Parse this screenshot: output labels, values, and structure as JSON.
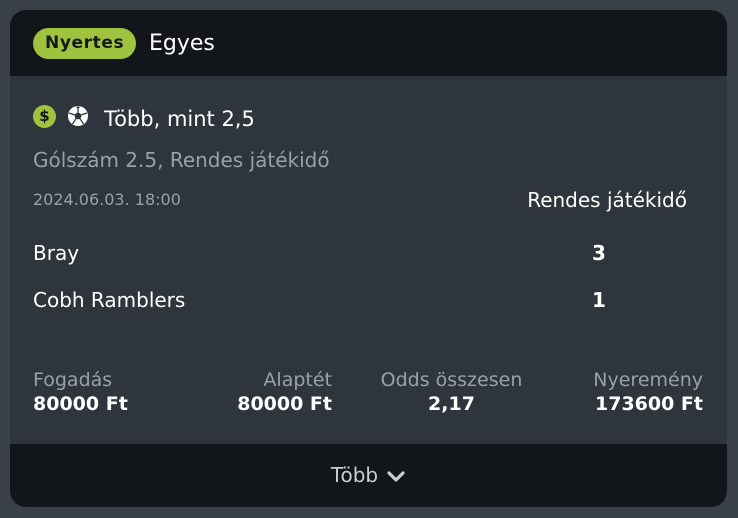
{
  "header": {
    "status_badge": "Nyertes",
    "bet_type": "Egyes"
  },
  "selection": {
    "icons": [
      "dollar-icon",
      "soccer-ball-icon"
    ],
    "name": "Több, mint 2,5",
    "market": "Gólszám 2.5, Rendes játékidő"
  },
  "match": {
    "datetime": "2024.06.03.  18:00",
    "period_label": "Rendes játékidő",
    "home": {
      "name": "Bray",
      "score": "3"
    },
    "away": {
      "name": "Cobh Ramblers",
      "score": "1"
    }
  },
  "stats": {
    "stake": {
      "label": "Fogadás",
      "value": "80000 Ft"
    },
    "base_stake": {
      "label": "Alaptét",
      "value": "80000 Ft"
    },
    "total_odds": {
      "label": "Odds összesen",
      "value": "2,17"
    },
    "winnings": {
      "label": "Nyeremény",
      "value": "173600 Ft"
    }
  },
  "footer": {
    "more_label": "Több"
  },
  "colors": {
    "accent": "#9fc33f",
    "card_bg": "#2e353c",
    "header_bg": "#12161b",
    "muted_text": "#9aa0a6"
  }
}
